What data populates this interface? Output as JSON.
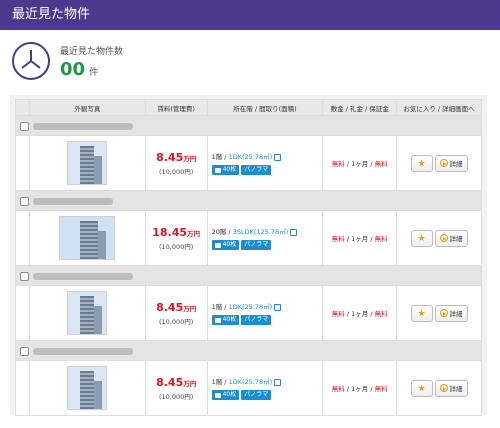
{
  "header": {
    "title": "最近見た物件"
  },
  "summary": {
    "label": "最近見た物件数",
    "count": "00",
    "unit": "件"
  },
  "table": {
    "headers": [
      "外観写真",
      "賃料(管理費)",
      "所在階 / 間取り(面積)",
      "敷金 / 礼金 / 保証金",
      "お気に入り / 詳細画面へ"
    ],
    "rows": [
      {
        "price": "8.45",
        "price_unit": "万円",
        "mgmt": "(10,000円)",
        "floor": "1階 / ",
        "layout": "1DK(25.78㎡)",
        "photos": "40枚",
        "panorama": "パノラマ",
        "fee1": "無料",
        "fee2": " / 1ヶ月 / ",
        "fee3": "無料",
        "detail": "詳細"
      },
      {
        "price": "18.45",
        "price_unit": "万円",
        "mgmt": "(10,000円)",
        "floor": "20階 / ",
        "layout": "3SLDK(125.78㎡)",
        "photos": "40枚",
        "panorama": "パノラマ",
        "fee1": "無料",
        "fee2": " / 1ヶ月 / ",
        "fee3": "無料",
        "detail": "詳細"
      },
      {
        "price": "8.45",
        "price_unit": "万円",
        "mgmt": "(10,000円)",
        "floor": "1階 / ",
        "layout": "1DK(25.78㎡)",
        "photos": "40枚",
        "panorama": "パノラマ",
        "fee1": "無料",
        "fee2": " / 1ヶ月 / ",
        "fee3": "無料",
        "detail": "詳細"
      },
      {
        "price": "8.45",
        "price_unit": "万円",
        "mgmt": "(10,000円)",
        "floor": "1階 / ",
        "layout": "1DK(25.78㎡)",
        "photos": "40枚",
        "panorama": "パノラマ",
        "fee1": "無料",
        "fee2": " / 1ヶ月 / ",
        "fee3": "無料",
        "detail": "詳細"
      }
    ]
  }
}
